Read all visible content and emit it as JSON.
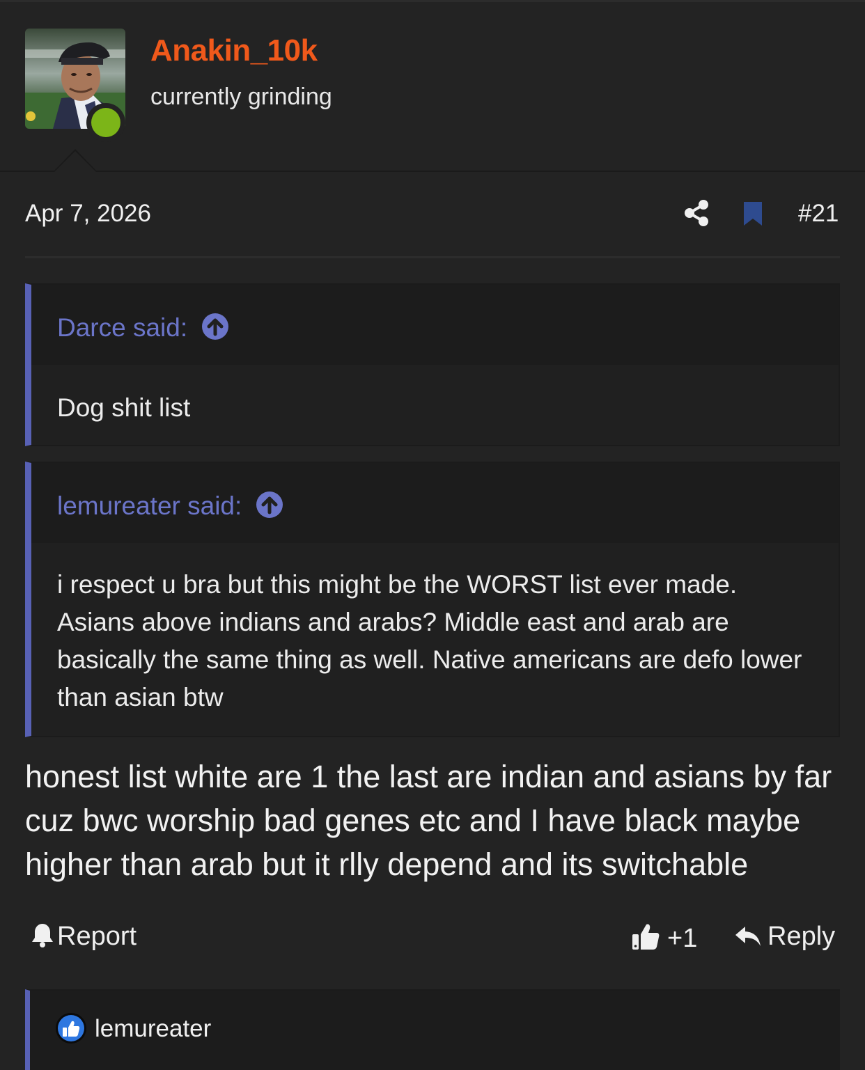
{
  "user": {
    "name": "Anakin_10k",
    "title": "currently grinding",
    "status": "online"
  },
  "post": {
    "date": "Apr 7, 2026",
    "number": "#21",
    "body": "honest list white are 1 the last are indian and asians by far cuz bwc worship bad genes etc and I have black maybe higher than arab but it rlly depend and its switchable"
  },
  "quotes": [
    {
      "author_label": "Darce said:",
      "text": "Dog shit list"
    },
    {
      "author_label": "lemureater said:",
      "text": "i respect u bra but this might be the WORST list ever made. Asians above indians and arabs? Middle east and arab are basically the same thing as well. Native americans are defo lower than asian btw"
    }
  ],
  "actions": {
    "report": "Report",
    "like": "+1",
    "reply": "Reply"
  },
  "reactions": {
    "users": [
      "lemureater"
    ]
  },
  "colors": {
    "background": "#232323",
    "username": "#f0591b",
    "quote_accent": "#5861b5",
    "online": "#7cb518",
    "bookmark": "#2e4b8f"
  },
  "icons": [
    "share-icon",
    "bookmark-icon",
    "arrow-up-circle-icon",
    "bell-icon",
    "thumbs-up-icon",
    "reply-arrow-icon",
    "like-badge-icon"
  ]
}
